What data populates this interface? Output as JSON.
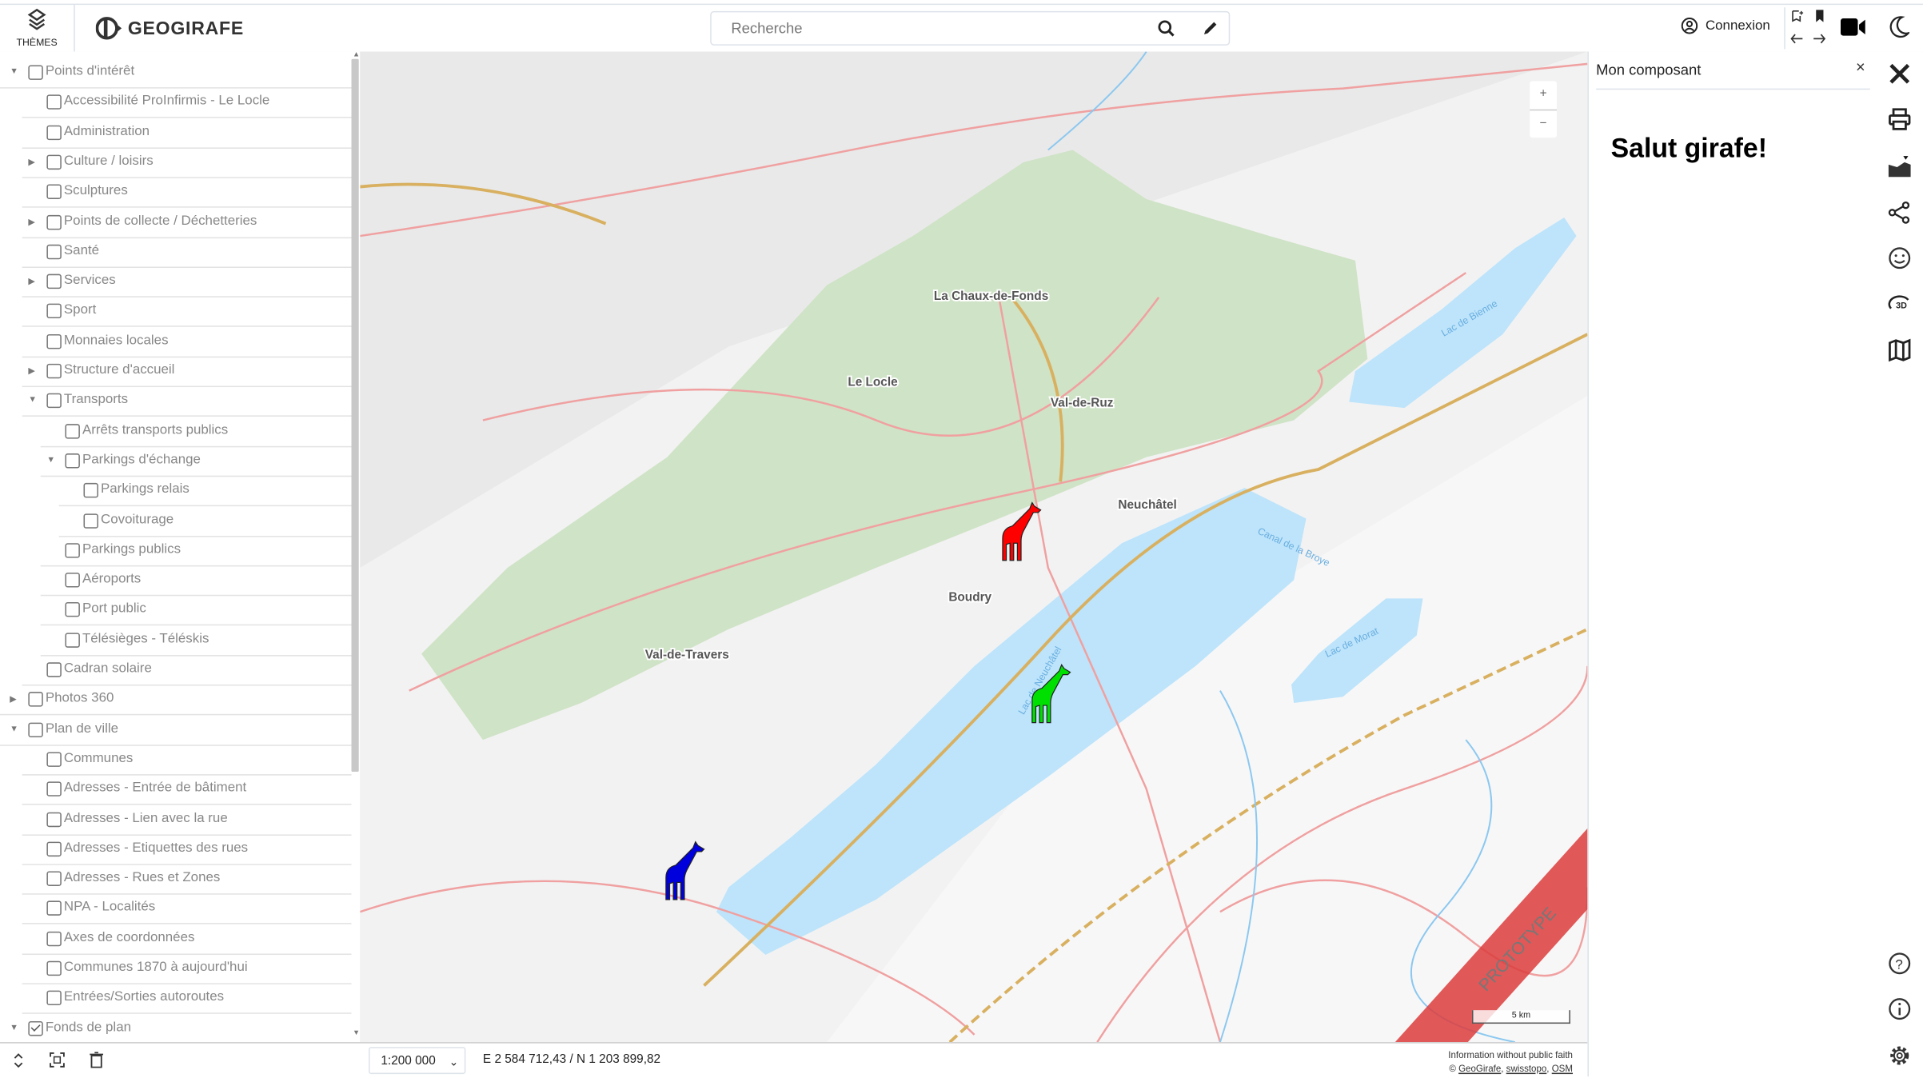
{
  "header": {
    "themes_label": "THÈMES",
    "logo_text": "GEOGIRAFE",
    "search_placeholder": "Recherche",
    "login_label": "Connexion"
  },
  "layer_tree": [
    {
      "label": "Points d'intérêt",
      "level": 0,
      "expander": "expanded",
      "checked": false
    },
    {
      "label": "Accessibilité ProInfirmis - Le Locle",
      "level": 1,
      "expander": "none",
      "checked": false
    },
    {
      "label": "Administration",
      "level": 1,
      "expander": "none",
      "checked": false
    },
    {
      "label": "Culture / loisirs",
      "level": 1,
      "expander": "collapsed",
      "checked": false
    },
    {
      "label": "Sculptures",
      "level": 1,
      "expander": "none",
      "checked": false
    },
    {
      "label": "Points de collecte / Déchetteries",
      "level": 1,
      "expander": "collapsed",
      "checked": false
    },
    {
      "label": "Santé",
      "level": 1,
      "expander": "none",
      "checked": false
    },
    {
      "label": "Services",
      "level": 1,
      "expander": "collapsed",
      "checked": false
    },
    {
      "label": "Sport",
      "level": 1,
      "expander": "none",
      "checked": false
    },
    {
      "label": "Monnaies locales",
      "level": 1,
      "expander": "none",
      "checked": false
    },
    {
      "label": "Structure d'accueil",
      "level": 1,
      "expander": "collapsed",
      "checked": false
    },
    {
      "label": "Transports",
      "level": 1,
      "expander": "expanded",
      "checked": false
    },
    {
      "label": "Arrêts transports publics",
      "level": 2,
      "expander": "none",
      "checked": false
    },
    {
      "label": "Parkings d'échange",
      "level": 2,
      "expander": "expanded",
      "checked": false
    },
    {
      "label": "Parkings relais",
      "level": 3,
      "expander": "none",
      "checked": false
    },
    {
      "label": "Covoiturage",
      "level": 3,
      "expander": "none",
      "checked": false
    },
    {
      "label": "Parkings publics",
      "level": 2,
      "expander": "none",
      "checked": false
    },
    {
      "label": "Aéroports",
      "level": 2,
      "expander": "none",
      "checked": false
    },
    {
      "label": "Port public",
      "level": 2,
      "expander": "none",
      "checked": false
    },
    {
      "label": "Télésièges - Téléskis",
      "level": 2,
      "expander": "none",
      "checked": false
    },
    {
      "label": "Cadran solaire",
      "level": 1,
      "expander": "none",
      "checked": false
    },
    {
      "label": "Photos 360",
      "level": 0,
      "expander": "collapsed",
      "checked": false
    },
    {
      "label": "Plan de ville",
      "level": 0,
      "expander": "expanded",
      "checked": false
    },
    {
      "label": "Communes",
      "level": 1,
      "expander": "none",
      "checked": false
    },
    {
      "label": "Adresses - Entrée de bâtiment",
      "level": 1,
      "expander": "none",
      "checked": false
    },
    {
      "label": "Adresses - Lien avec la rue",
      "level": 1,
      "expander": "none",
      "checked": false
    },
    {
      "label": "Adresses - Etiquettes des rues",
      "level": 1,
      "expander": "none",
      "checked": false
    },
    {
      "label": "Adresses - Rues et Zones",
      "level": 1,
      "expander": "none",
      "checked": false
    },
    {
      "label": "NPA - Localités",
      "level": 1,
      "expander": "none",
      "checked": false
    },
    {
      "label": "Axes de coordonnées",
      "level": 1,
      "expander": "none",
      "checked": false
    },
    {
      "label": "Communes 1870 à aujourd'hui",
      "level": 1,
      "expander": "none",
      "checked": false
    },
    {
      "label": "Entrées/Sorties autoroutes",
      "level": 1,
      "expander": "none",
      "checked": false
    },
    {
      "label": "Fonds de plan",
      "level": 0,
      "expander": "expanded",
      "checked": true
    }
  ],
  "map": {
    "labels": {
      "chaux_de_fonds": "La Chaux-de-Fonds",
      "le_locle": "Le Locle",
      "val_de_ruz": "Val-de-Ruz",
      "neuchatel": "Neuchâtel",
      "boudry": "Boudry",
      "val_de_travers": "Val-de-Travers",
      "lac_bienne": "Lac de Bienne",
      "lac_morat": "Lac de Morat",
      "canal_broye": "Canal de la Broye",
      "lac_neuchatel": "Lac de Neuchâtel"
    },
    "zoom_in": "+",
    "zoom_out": "−",
    "scale_bar": "5 km",
    "watermark": "PROTOTYPE",
    "markers": [
      {
        "icon": "giraffe-icon",
        "color": "#ff0000"
      },
      {
        "icon": "giraffe-icon",
        "color": "#00e000"
      },
      {
        "icon": "giraffe-icon",
        "color": "#0000dd"
      }
    ]
  },
  "footer": {
    "scale": "1:200 000",
    "coordinates": "E 2 584 712,43 / N 1 203 899,82",
    "disclaimer": "Information without public faith",
    "copyright": "©",
    "attr_geogirafe": "GeoGirafe",
    "attr_swisstopo": "swisstopo",
    "attr_osm": "OSM"
  },
  "panel": {
    "title": "Mon composant",
    "close": "×",
    "content_heading": "Salut girafe!"
  }
}
